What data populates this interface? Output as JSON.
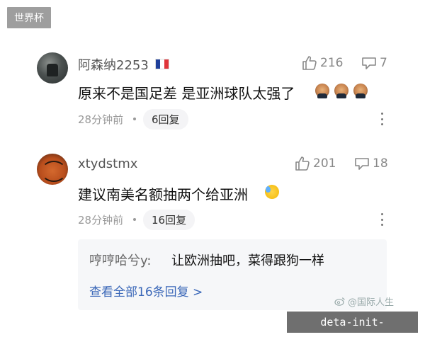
{
  "corner_tag": "世界杯",
  "comments": [
    {
      "username": "阿森纳2253",
      "flag": "france",
      "text": "原来不是国足差 是亚洲球队太强了",
      "emojis": [
        "player-face",
        "player-face",
        "player-face"
      ],
      "likes": "216",
      "shares": "7",
      "time": "28分钟前",
      "reply_count": "6回复"
    },
    {
      "username": "xtydstmx",
      "text": "建议南美名额抽两个给亚洲",
      "emojis": [
        "sweat-smile"
      ],
      "likes": "201",
      "shares": "18",
      "time": "28分钟前",
      "reply_count": "16回复",
      "sub_reply": {
        "author": "哼哼哈兮y:",
        "content": "让欧洲抽吧，菜得跟狗一样",
        "view_all": "查看全部16条回复 >"
      }
    }
  ],
  "watermark": "@国际人生",
  "site_tag": "deta-init-fifa.com.cn",
  "colors": {
    "link": "#3a67b8",
    "meta": "#999999",
    "reply_bg": "#f6f7f9"
  }
}
